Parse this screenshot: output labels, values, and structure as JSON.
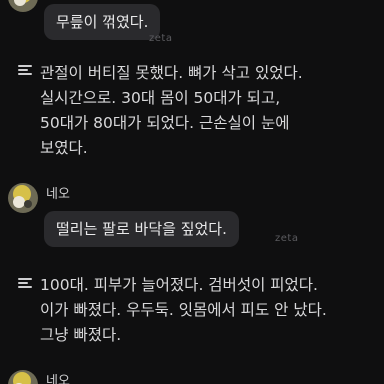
{
  "messages": [
    {
      "type": "bubble",
      "text": "무릎이 꺾였다.",
      "watermark": "zeta"
    },
    {
      "type": "narration",
      "lines": [
        "관절이 버티질 못했다. 뼈가 삭고 있었다.",
        "실시간으로. 30대 몸이 50대가 되고,",
        "50대가 80대가 되었다. 근손실이 눈에",
        "보였다."
      ]
    },
    {
      "type": "character",
      "name": "네오",
      "text": "떨리는 팔로 바닥을 짚었다.",
      "watermark": "zeta"
    },
    {
      "type": "narration",
      "lines": [
        "100대. 피부가 늘어졌다. 검버섯이 피었다.",
        "이가 빠졌다. 우두둑. 잇몸에서 피도 안 났다.",
        "그냥 빠졌다."
      ]
    },
    {
      "type": "character",
      "name": "네오"
    }
  ],
  "colors": {
    "background": "#0f0f10",
    "bubble": "#2a2a2d",
    "text": "#e9e9ea"
  },
  "icons": {
    "narration": "narration-lines-icon",
    "avatar": "character-avatar"
  }
}
